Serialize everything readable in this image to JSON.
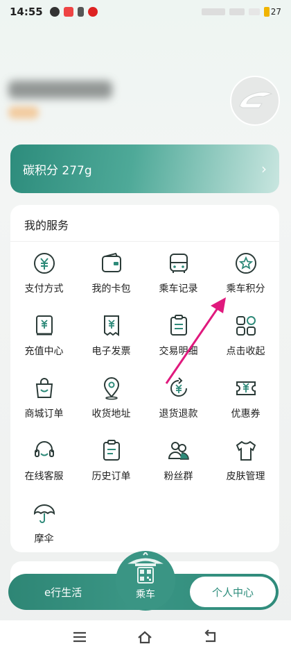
{
  "status_bar": {
    "time": "14:55",
    "battery": "27"
  },
  "carbon": {
    "label": "碳积分 277g"
  },
  "services": {
    "title": "我的服务",
    "items": [
      {
        "label": "支付方式",
        "icon": "yuan-coin-icon"
      },
      {
        "label": "我的卡包",
        "icon": "wallet-icon"
      },
      {
        "label": "乘车记录",
        "icon": "bus-icon"
      },
      {
        "label": "乘车积分",
        "icon": "star-badge-icon"
      },
      {
        "label": "充值中心",
        "icon": "recharge-book-icon"
      },
      {
        "label": "电子发票",
        "icon": "invoice-icon"
      },
      {
        "label": "交易明细",
        "icon": "clipboard-icon"
      },
      {
        "label": "点击收起",
        "icon": "grid-collapse-icon"
      },
      {
        "label": "商城订单",
        "icon": "shopping-bag-icon"
      },
      {
        "label": "收货地址",
        "icon": "location-pin-icon"
      },
      {
        "label": "退货退款",
        "icon": "refund-icon"
      },
      {
        "label": "优惠券",
        "icon": "coupon-icon"
      },
      {
        "label": "在线客服",
        "icon": "headset-icon"
      },
      {
        "label": "历史订单",
        "icon": "history-clipboard-icon"
      },
      {
        "label": "粉丝群",
        "icon": "group-icon"
      },
      {
        "label": "皮肤管理",
        "icon": "shirt-icon"
      },
      {
        "label": "摩伞",
        "icon": "umbrella-icon"
      }
    ]
  },
  "tabbar": {
    "elife": "e行生活",
    "ride": "乘车",
    "personal": "个人中心"
  },
  "colors": {
    "accent": "#2e8a79",
    "icon_stroke": "#2b3b38",
    "icon_accent": "#2e8a79",
    "arrow": "#e0197d"
  }
}
